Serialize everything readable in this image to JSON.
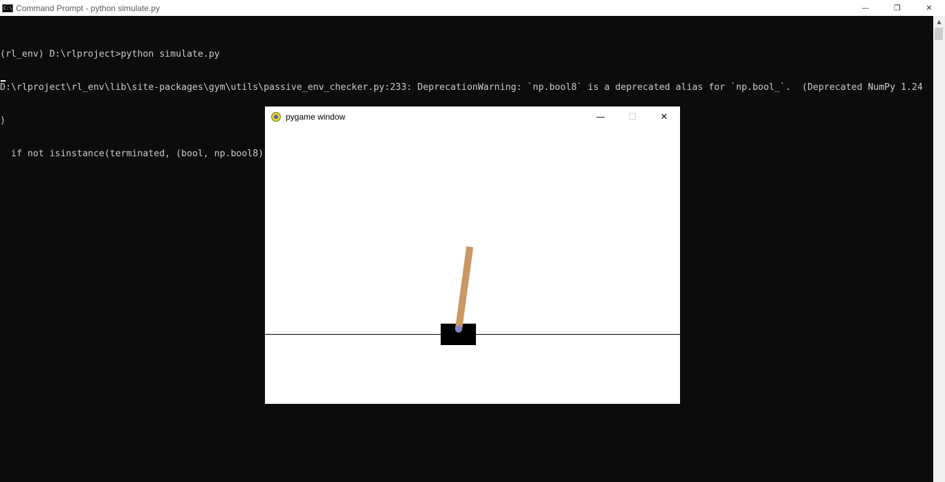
{
  "cmd": {
    "title": "Command Prompt - python  simulate.py",
    "icon_text": "C:\\",
    "controls": {
      "minimize": "—",
      "restore": "❐",
      "close": "✕"
    },
    "lines": [
      "(rl_env) D:\\rlproject>python simulate.py",
      "D:\\rlproject\\rl_env\\lib\\site-packages\\gym\\utils\\passive_env_checker.py:233: DeprecationWarning: `np.bool8` is a deprecated alias for `np.bool_`.  (Deprecated NumPy 1.24",
      ")",
      "  if not isinstance(terminated, (bool, np.bool8)):"
    ]
  },
  "scrollbar": {
    "up_arrow": "▲"
  },
  "pygame": {
    "title": "pygame window",
    "controls": {
      "minimize": "—",
      "maximize": "☐",
      "close": "✕"
    },
    "scene": {
      "background": "#ffffff",
      "track_color": "#000000",
      "cart_color": "#000000",
      "pole_color": "#ca9865",
      "axle_color": "#8184cb"
    }
  }
}
